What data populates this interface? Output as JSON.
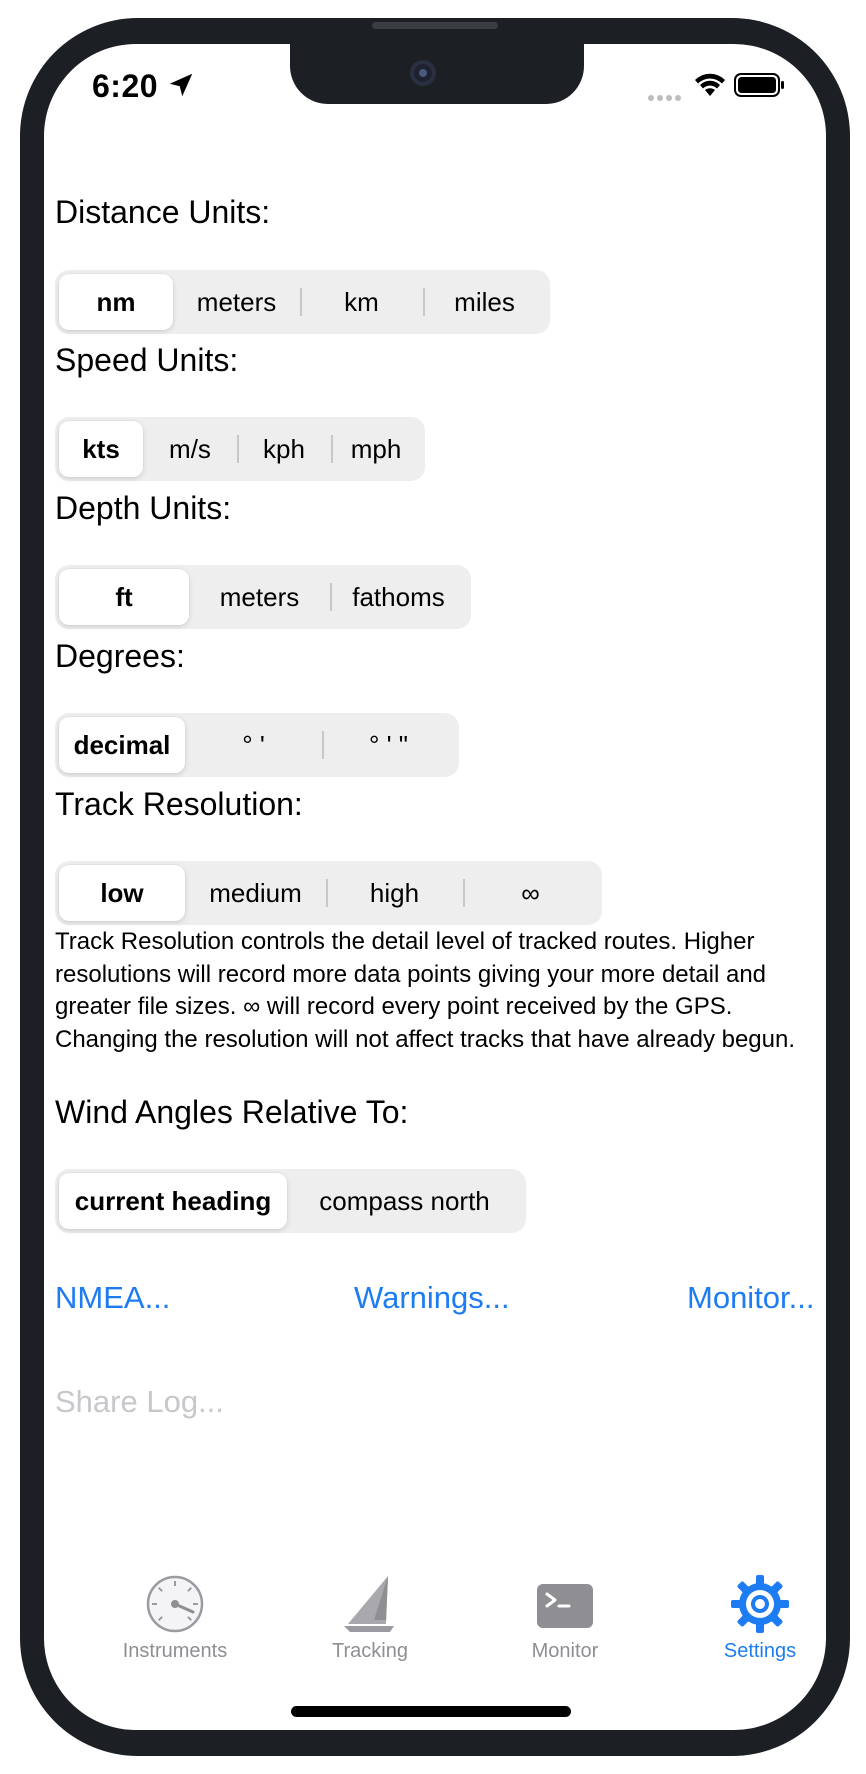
{
  "status_bar": {
    "time": "6:20"
  },
  "settings": [
    {
      "label": "Distance Units:",
      "options": [
        "nm",
        "meters",
        "km",
        "miles"
      ],
      "selected": 0
    },
    {
      "label": "Speed Units:",
      "options": [
        "kts",
        "m/s",
        "kph",
        "mph"
      ],
      "selected": 0
    },
    {
      "label": "Depth Units:",
      "options": [
        "ft",
        "meters",
        "fathoms"
      ],
      "selected": 0
    },
    {
      "label": "Degrees:",
      "options": [
        "decimal",
        "° '",
        "° ' \""
      ],
      "selected": 0
    },
    {
      "label": "Track Resolution:",
      "options": [
        "low",
        "medium",
        "high",
        "∞"
      ],
      "selected": 0
    },
    {
      "label": "Wind Angles Relative To:",
      "options": [
        "current heading",
        "compass north"
      ],
      "selected": 0
    }
  ],
  "track_resolution_help": "Track Resolution controls the detail level of tracked routes. Higher resolutions will record more data points giving your more detail and greater file sizes. ∞ will record every point received by the GPS. Changing the resolution will not affect tracks that have already begun.",
  "links": {
    "nmea": "NMEA...",
    "warnings": "Warnings...",
    "monitor": "Monitor...",
    "share_log": "Share Log..."
  },
  "tabs": [
    {
      "label": "Instruments",
      "icon": "gauge-icon"
    },
    {
      "label": "Tracking",
      "icon": "sailboat-icon"
    },
    {
      "label": "Monitor",
      "icon": "terminal-icon"
    },
    {
      "label": "Settings",
      "icon": "gear-icon",
      "active": true
    }
  ],
  "colors": {
    "accent": "#1d7cf2",
    "tab_inactive": "#8e8e93",
    "segment_bg": "#eeeeef",
    "disabled": "#c7c7cc"
  }
}
